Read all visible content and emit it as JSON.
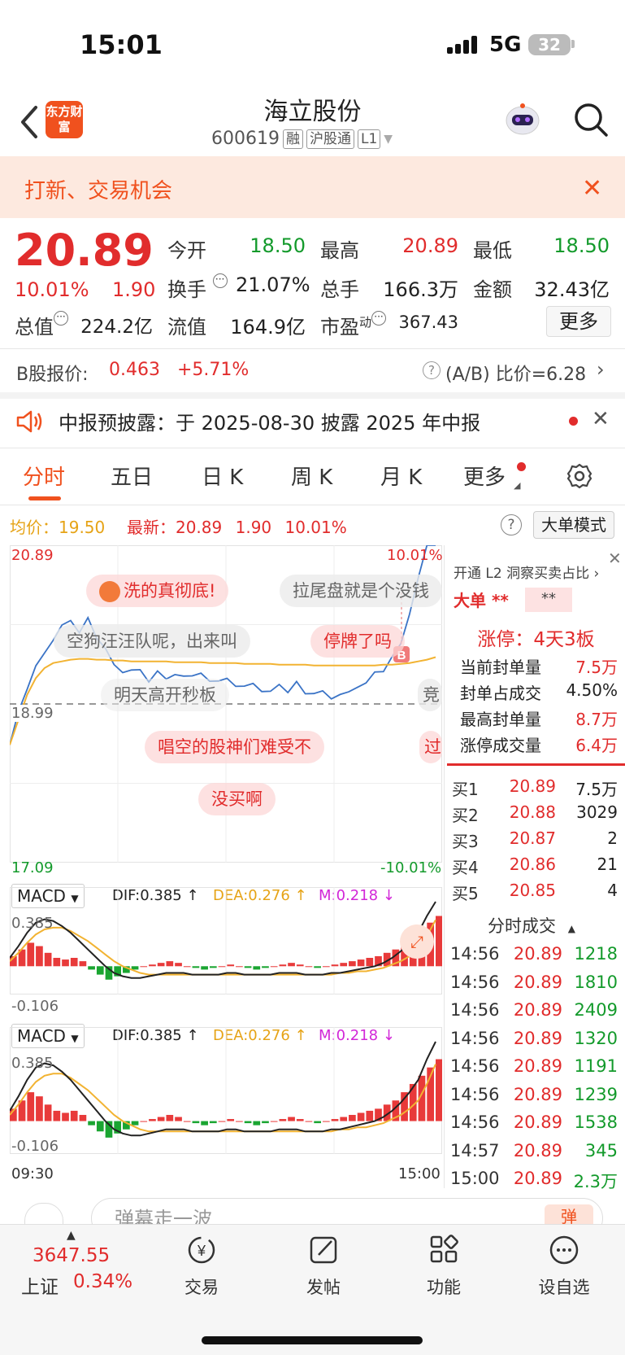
{
  "status_bar": {
    "time": "15:01",
    "network": "5G",
    "battery": "32"
  },
  "header": {
    "logo_text": "东方财富",
    "stock_name": "海立股份",
    "stock_code": "600619",
    "tags": [
      "融",
      "沪股通",
      "L1"
    ]
  },
  "banner": {
    "text": "打新、交易机会"
  },
  "quote": {
    "price": "20.89",
    "change_pct": "10.01%",
    "change": "1.90",
    "fields": {
      "open_label": "今开",
      "open": "18.50",
      "high_label": "最高",
      "high": "20.89",
      "low_label": "最低",
      "low": "18.50",
      "turnover_label": "换手",
      "turnover": "21.07%",
      "volume_label": "总手",
      "volume": "166.3万",
      "amount_label": "金额",
      "amount": "32.43亿",
      "mktcap_label": "总值",
      "mktcap": "224.2亿",
      "float_label": "流值",
      "float": "164.9亿",
      "pe_label": "市盈",
      "pe_sup": "动",
      "pe": "367.43"
    },
    "more_label": "更多"
  },
  "b_share": {
    "label": "B股报价:",
    "price": "0.463",
    "pct": "+5.71%",
    "ratio_label": "(A/B) 比价=6.28"
  },
  "notice": {
    "text": "中报预披露：于 2025-08-30 披露 2025 年中报"
  },
  "tabs": [
    "分时",
    "五日",
    "日 K",
    "周 K",
    "月 K",
    "更多"
  ],
  "chart_info": {
    "avg_label": "均价：",
    "avg": "19.50",
    "latest_label": "最新：",
    "latest": "20.89",
    "chg": "1.90",
    "pct": "10.01%",
    "big_order_label": "大单模式"
  },
  "chart_data": {
    "type": "line",
    "y_top": "20.89",
    "y_mid": "18.99",
    "y_bottom": "17.09",
    "pct_top": "10.01%",
    "pct_bottom": "-10.01%",
    "x_start": "09:30",
    "x_end": "15:00",
    "ylim": [
      17.09,
      20.89
    ],
    "series": [
      {
        "values": [
          18.5,
          18.9,
          19.2,
          19.4,
          19.6,
          19.8,
          19.9,
          20.0,
          19.9,
          20.0,
          19.8,
          19.6,
          19.45,
          19.4,
          19.35,
          19.4,
          19.3,
          19.35,
          19.3,
          19.4,
          19.3,
          19.35,
          19.3,
          19.25,
          19.3,
          19.25,
          19.2,
          19.25,
          19.2,
          19.15,
          19.2,
          19.2,
          19.15,
          19.2,
          19.1,
          19.15,
          19.1,
          19.05,
          19.15,
          19.1,
          19.2,
          19.3,
          19.35,
          19.4,
          19.5,
          19.7,
          20.1,
          20.5,
          20.89,
          20.89
        ]
      },
      {
        "values": [
          18.5,
          18.8,
          19.1,
          19.3,
          19.42,
          19.48,
          19.5,
          19.52,
          19.53,
          19.53,
          19.52,
          19.52,
          19.51,
          19.51,
          19.5,
          19.5,
          19.5,
          19.5,
          19.5,
          19.49,
          19.49,
          19.49,
          19.49,
          19.48,
          19.48,
          19.48,
          19.48,
          19.47,
          19.47,
          19.47,
          19.47,
          19.46,
          19.46,
          19.46,
          19.46,
          19.45,
          19.45,
          19.45,
          19.45,
          19.45,
          19.45,
          19.45,
          19.45,
          19.46,
          19.46,
          19.47,
          19.48,
          19.5,
          19.52,
          19.55
        ]
      }
    ],
    "macd": {
      "dif_label": "DIF:0.385 ↑",
      "dea_label": "DEA:0.276 ↑",
      "m_label": "M:0.218 ↓",
      "y_top": "0.385",
      "y_bottom": "-0.106",
      "hist": [
        0.06,
        0.1,
        0.14,
        0.12,
        0.08,
        0.05,
        0.04,
        0.05,
        0.03,
        -0.02,
        -0.05,
        -0.08,
        -0.06,
        -0.04,
        -0.02,
        0.0,
        0.01,
        0.02,
        0.03,
        0.02,
        0.0,
        -0.01,
        -0.02,
        -0.01,
        0.0,
        0.01,
        0.0,
        -0.01,
        -0.02,
        -0.01,
        0.0,
        0.01,
        0.02,
        0.01,
        0.0,
        -0.01,
        0.0,
        0.01,
        0.02,
        0.03,
        0.04,
        0.05,
        0.06,
        0.08,
        0.1,
        0.14,
        0.18,
        0.22,
        0.26,
        0.3
      ],
      "dif": [
        0.05,
        0.12,
        0.2,
        0.26,
        0.28,
        0.27,
        0.24,
        0.2,
        0.15,
        0.1,
        0.05,
        0.0,
        -0.04,
        -0.06,
        -0.07,
        -0.07,
        -0.06,
        -0.05,
        -0.04,
        -0.04,
        -0.04,
        -0.05,
        -0.05,
        -0.05,
        -0.05,
        -0.04,
        -0.04,
        -0.05,
        -0.05,
        -0.05,
        -0.05,
        -0.04,
        -0.04,
        -0.04,
        -0.05,
        -0.05,
        -0.05,
        -0.04,
        -0.04,
        -0.03,
        -0.02,
        -0.01,
        0.0,
        0.02,
        0.05,
        0.09,
        0.14,
        0.2,
        0.3,
        0.385
      ],
      "dea": [
        0.03,
        0.08,
        0.14,
        0.19,
        0.22,
        0.23,
        0.23,
        0.21,
        0.18,
        0.15,
        0.11,
        0.07,
        0.03,
        0.0,
        -0.02,
        -0.04,
        -0.05,
        -0.05,
        -0.05,
        -0.05,
        -0.05,
        -0.05,
        -0.05,
        -0.05,
        -0.05,
        -0.05,
        -0.05,
        -0.05,
        -0.05,
        -0.05,
        -0.05,
        -0.05,
        -0.05,
        -0.05,
        -0.05,
        -0.05,
        -0.05,
        -0.05,
        -0.04,
        -0.04,
        -0.03,
        -0.03,
        -0.02,
        -0.01,
        0.01,
        0.03,
        0.06,
        0.1,
        0.18,
        0.276
      ]
    }
  },
  "barrages": [
    "洗的真彻底!",
    "拉尾盘就是个没钱",
    "空狗汪汪队呢，出来叫",
    "停牌了吗",
    "明天高开秒板",
    "唱空的股神们难受不",
    "没买啊",
    "竞",
    "过"
  ],
  "right_panel": {
    "l2_text": "开通 L2 洞察买卖占比 ›",
    "big_label": "大单",
    "big_stars": "**",
    "masked": "**",
    "limit_up": "涨停：4天3板",
    "stats": [
      {
        "label": "当前封单量",
        "value": "7.5万"
      },
      {
        "label": "封单占成交",
        "value": "4.50%"
      },
      {
        "label": "最高封单量",
        "value": "8.7万"
      },
      {
        "label": "涨停成交量",
        "value": "6.4万"
      }
    ],
    "bids": [
      {
        "level": "买1",
        "price": "20.89",
        "vol": "7.5万"
      },
      {
        "level": "买2",
        "price": "20.88",
        "vol": "3029"
      },
      {
        "level": "买3",
        "price": "20.87",
        "vol": "2"
      },
      {
        "level": "买4",
        "price": "20.86",
        "vol": "21"
      },
      {
        "level": "买5",
        "price": "20.85",
        "vol": "4"
      }
    ],
    "ticks_title": "分时成交",
    "ticks": [
      {
        "t": "14:56",
        "p": "20.89",
        "v": "1218"
      },
      {
        "t": "14:56",
        "p": "20.89",
        "v": "1810"
      },
      {
        "t": "14:56",
        "p": "20.89",
        "v": "2409"
      },
      {
        "t": "14:56",
        "p": "20.89",
        "v": "1320"
      },
      {
        "t": "14:56",
        "p": "20.89",
        "v": "1191"
      },
      {
        "t": "14:56",
        "p": "20.89",
        "v": "1239"
      },
      {
        "t": "14:56",
        "p": "20.89",
        "v": "1538"
      },
      {
        "t": "14:57",
        "p": "20.89",
        "v": "345"
      },
      {
        "t": "15:00",
        "p": "20.89",
        "v": "2.3万"
      }
    ]
  },
  "comment": {
    "placeholder": "弹幕走一波",
    "barrage_btn": "弹"
  },
  "bottom_nav": {
    "index_value": "3647.55",
    "index_name": "上证",
    "index_pct": "0.34%",
    "items": [
      "交易",
      "发帖",
      "功能",
      "设自选"
    ]
  }
}
